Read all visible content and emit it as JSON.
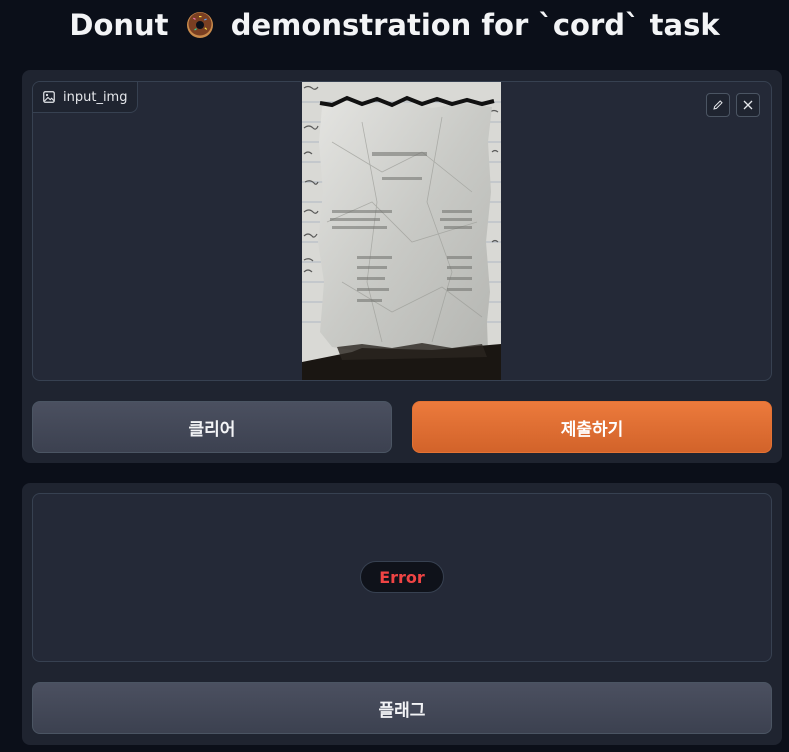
{
  "header": {
    "title_prefix": "Donut",
    "title_suffix": "demonstration for `cord` task",
    "title_icon": "donut-emoji-icon"
  },
  "input": {
    "label": "input_img",
    "label_icon": "image-icon",
    "tools": [
      "pencil-icon",
      "close-icon"
    ]
  },
  "actions": {
    "clear_label": "클리어",
    "submit_label": "제출하기"
  },
  "output": {
    "status": "Error",
    "flag_label": "플래그"
  },
  "colors": {
    "background": "#0b0f19",
    "panel": "#1f2430",
    "accent_orange": "#e06a2f",
    "error_red": "#ef4444"
  }
}
